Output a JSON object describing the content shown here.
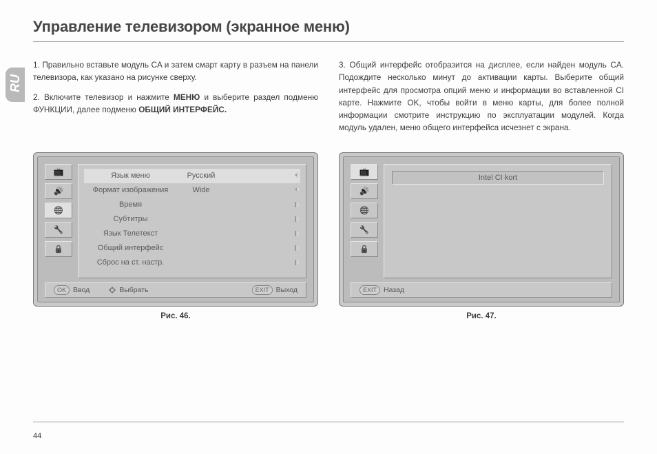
{
  "title": "Управление телевизором (экранное меню)",
  "lang_tab": "RU",
  "page_number": "44",
  "col1": {
    "p1": "1. Правильно вставьте модуль CA и затем смарт карту в разъем на панели телевизора, как указано на рисунке сверху.",
    "p2_pre": "2. Включите телевизор и нажмите ",
    "p2_b1": "МЕНЮ",
    "p2_mid": " и выберите раздел подменю ФУНКЦИИ, далее подменю ",
    "p2_b2": "ОБЩИЙ ИНТЕРФЕЙС."
  },
  "col2": {
    "p1": "3. Общий интерфейс отобразится на дисплее, если найден модуль CA. Подождите несколько минут до активации карты. Выберите общий интерфейс для просмотра опций меню и информации во вставленной CI карте. Нажмите OK, чтобы войти в меню карты, для более полной информации смотрите инструкцию по эксплуатации модулей. Когда модуль удален, меню общего интерфейса исчезнет с экрана."
  },
  "fig46": {
    "caption": "Рис. 46.",
    "menu": [
      {
        "label": "Язык меню",
        "value": "Русский",
        "arrows": "lr"
      },
      {
        "label": "Формат изображения",
        "value": "Wide",
        "arrows": "lr"
      },
      {
        "label": "Время",
        "value": "",
        "arrows": "r1"
      },
      {
        "label": "Субтитры",
        "value": "",
        "arrows": "r1"
      },
      {
        "label": "Язык Телетекст",
        "value": "",
        "arrows": "r1"
      },
      {
        "label": "Общий интерфейс",
        "value": "",
        "arrows": "r1"
      },
      {
        "label": "Сброс на ст. настр.",
        "value": "",
        "arrows": "r1"
      }
    ],
    "footer": {
      "ok_key": "OK",
      "ok_label": "Ввод",
      "select_label": "Выбрать",
      "exit_key": "EXIT",
      "exit_label": "Выход"
    }
  },
  "fig47": {
    "caption": "Рис. 47.",
    "ci_label": "Intel CI kort",
    "footer": {
      "exit_key": "EXIT",
      "back_label": "Назад"
    }
  }
}
